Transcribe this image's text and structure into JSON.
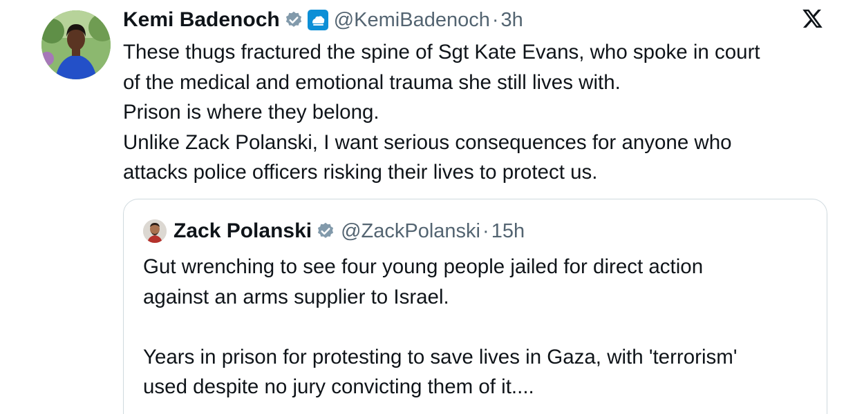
{
  "tweet": {
    "author_name": "Kemi Badenoch",
    "handle": "@KemiBadenoch",
    "separator": "·",
    "time": "3h",
    "verified_badge": "verified-badge-icon",
    "affiliate_badge": "conservative-tree-icon",
    "lines": [
      "These thugs fractured the spine of Sgt Kate Evans, who spoke in court",
      "of the medical and emotional trauma she still lives with.",
      "Prison is where they belong.",
      "Unlike Zack Polanski, I want serious consequences for anyone who",
      "attacks police officers risking their lives to protect us."
    ]
  },
  "quoted_tweet": {
    "author_name": "Zack Polanski",
    "handle": "@ZackPolanski",
    "separator": "·",
    "time": "15h",
    "verified_badge": "verified-badge-icon",
    "paragraph1": [
      "Gut wrenching to see four young people jailed for direct action",
      "against an arms supplier to Israel."
    ],
    "paragraph2": [
      "Years in prison for protesting to save lives in Gaza, with 'terrorism'",
      "used despite no jury convicting them of it...."
    ]
  },
  "app": {
    "logo": "x-logo-icon"
  },
  "colors": {
    "text_primary": "#0f1419",
    "text_secondary": "#536471",
    "verified_gray": "#829aab",
    "org_badge_blue": "#0d8fd6",
    "border": "#cfd9de"
  }
}
